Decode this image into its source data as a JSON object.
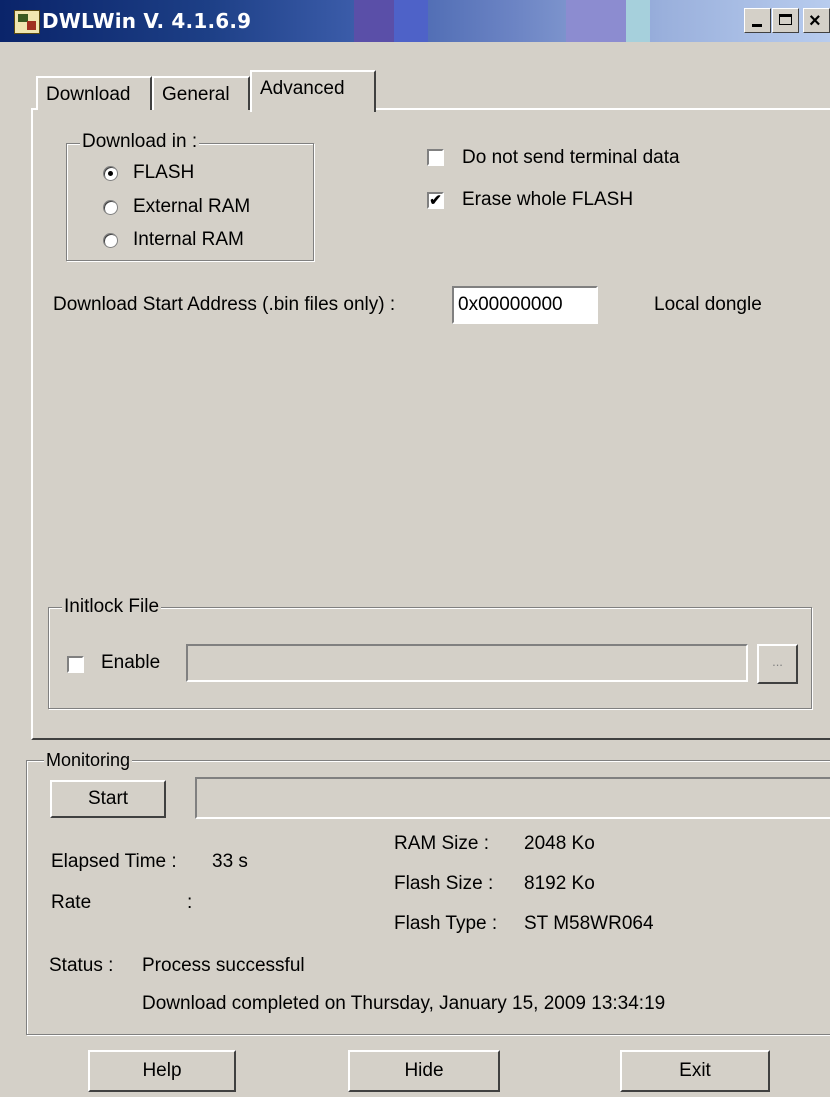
{
  "window": {
    "title": "DWLWin V. 4.1.6.9",
    "controls": [
      "minimize-icon",
      "maximize-icon",
      "close-icon"
    ]
  },
  "tabs": [
    {
      "label": "Download",
      "active": false
    },
    {
      "label": "General",
      "active": false
    },
    {
      "label": "Advanced",
      "active": true
    }
  ],
  "download_in": {
    "legend": "Download in :",
    "options": [
      {
        "label": "FLASH",
        "selected": true
      },
      {
        "label": "External RAM",
        "selected": false
      },
      {
        "label": "Internal RAM",
        "selected": false
      }
    ]
  },
  "options": {
    "no_terminal": {
      "label": "Do not send terminal data",
      "checked": false
    },
    "erase_flash": {
      "label": "Erase whole FLASH",
      "checked": true
    }
  },
  "start_address": {
    "label": "Download Start Address (.bin files only) :",
    "value": "0x00000000",
    "dongle": "Local dongle"
  },
  "initlock": {
    "legend": "Initlock File",
    "enable_label": "Enable",
    "enabled": false,
    "path": "",
    "browse_label": "..."
  },
  "monitoring": {
    "legend": "Monitoring",
    "start_label": "Start",
    "elapsed_label": "Elapsed Time :",
    "elapsed_value": "33 s",
    "rate_label": "Rate",
    "rate_sep": ":",
    "ram_label": "RAM Size :",
    "ram_value": "2048 Ko",
    "flash_size_label": "Flash Size :",
    "flash_size_value": "8192 Ko",
    "flash_type_label": "Flash Type :",
    "flash_type_value": "ST M58WR064",
    "status_label": "Status :",
    "status_value": "Process successful",
    "completed": "Download completed on Thursday, January 15, 2009 13:34:19"
  },
  "footer": {
    "help": "Help",
    "hide": "Hide",
    "exit": "Exit"
  }
}
